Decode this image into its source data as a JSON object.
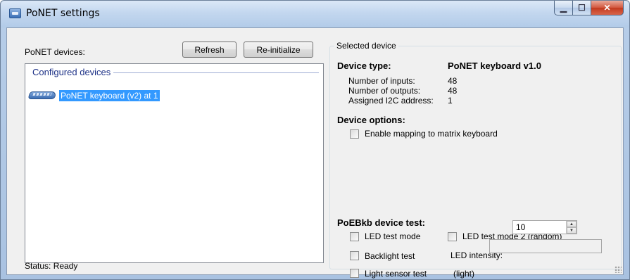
{
  "window": {
    "title": "PoNET settings",
    "minimize_glyph": "▁",
    "maximize_glyph": "☐",
    "close_glyph": "✕"
  },
  "left_panel": {
    "devices_label": "PoNET devices:",
    "refresh_button": "Refresh",
    "reinit_button": "Re-initialize",
    "group_header": "Configured devices",
    "items": [
      {
        "icon": "keyboard-icon",
        "label": "PoNET keyboard (v2) at 1",
        "selected": true
      }
    ],
    "status": "Status: Ready"
  },
  "selected_device": {
    "group_title": "Selected device",
    "device_type_label": "Device type:",
    "device_type_value": "PoNET keyboard v1.0",
    "inputs_label": "Number of inputs:",
    "inputs_value": "48",
    "outputs_label": "Number of outputs:",
    "outputs_value": "48",
    "i2c_label": "Assigned I2C address:",
    "i2c_value": "1",
    "options_header": "Device options:",
    "enable_mapping": "Enable mapping to matrix keyboard",
    "test_header": "PoEBkb device test:",
    "led_test_mode": "LED test mode",
    "led_test_mode_2": "LED test mode 2 (random)",
    "backlight_test": "Backlight test",
    "led_intensity_label": "LED intensity:",
    "led_intensity_value": "10",
    "light_sensor_test": "Light sensor test",
    "light_label": "(light)",
    "light_value": ""
  },
  "colors": {
    "selection": "#3399ff",
    "group_header": "#1e3287",
    "close_button": "#c23a1f"
  }
}
